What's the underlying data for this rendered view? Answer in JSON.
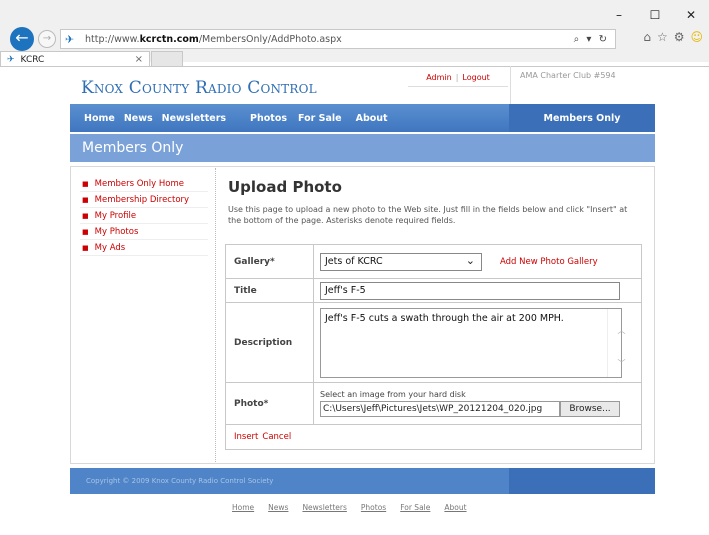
{
  "browser": {
    "url_prefix": "http://www.",
    "url_domain": "kcrctn.com",
    "url_path": "/MembersOnly/AddPhoto.aspx",
    "tab_label": "KCRC",
    "tab_close": "×",
    "minimize": "–",
    "maximize": "☐",
    "close": "✕",
    "addr_tools": "⌕ ▾ ↻"
  },
  "header": {
    "site_title": "Knox County Radio Control",
    "admin_link": "Admin",
    "link_sep": "|",
    "logout_link": "Logout",
    "charter": "AMA Charter Club #594"
  },
  "nav": {
    "items": [
      "Home",
      "News",
      "Newsletters",
      "Photos",
      "For Sale",
      "About"
    ],
    "members_only": "Members Only"
  },
  "banner": {
    "title": "Members Only"
  },
  "sidebar": {
    "items": [
      "Members Only Home",
      "Membership Directory",
      "My Profile",
      "My Photos",
      "My Ads"
    ]
  },
  "main": {
    "heading": "Upload Photo",
    "intro": "Use this page to upload a new photo to the Web site. Just fill in the fields below and click \"Insert\" at the bottom of the page. Asterisks denote required fields."
  },
  "form": {
    "gallery_label": "Gallery*",
    "gallery_value": "Jets of KCRC",
    "add_gallery_link": "Add New Photo Gallery",
    "title_label": "Title",
    "title_value": "Jeff's F-5",
    "description_label": "Description",
    "description_value": "Jeff's F-5 cuts a swath through the air at 200 MPH.",
    "photo_label": "Photo*",
    "photo_hint": "Select an image from your hard disk",
    "photo_path": "C:\\Users\\Jeff\\Pictures\\Jets\\WP_20121204_020.jpg",
    "browse_label": "Browse...",
    "insert_label": "Insert",
    "cancel_label": "Cancel"
  },
  "footer": {
    "copyright": "Copyright © 2009 Knox County Radio Control Society",
    "links": [
      "Home",
      "News",
      "Newsletters",
      "Photos",
      "For Sale",
      "About"
    ]
  }
}
